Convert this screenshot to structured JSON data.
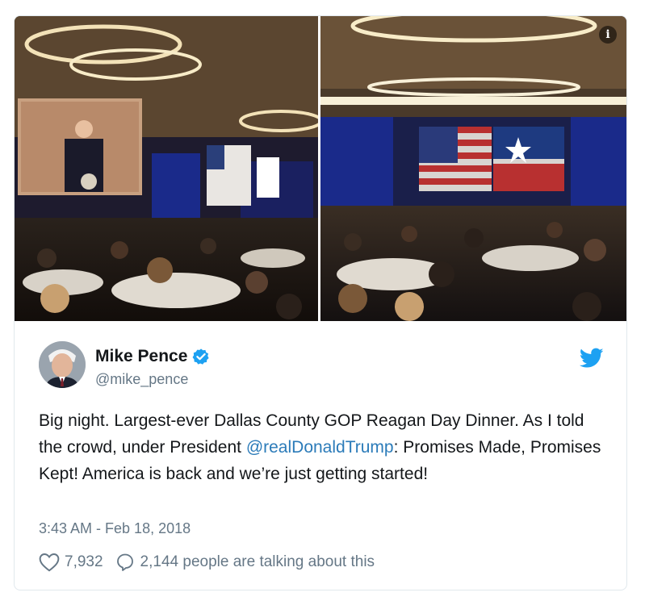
{
  "tweet": {
    "author": {
      "display_name": "Mike Pence",
      "handle": "@mike_pence",
      "verified": true
    },
    "text_before_mention": "Big night. Largest-ever Dallas County GOP Reagan Day Dinner. As I told the crowd, under President ",
    "mention": "@realDonaldTrump",
    "text_after_mention": ": Promises Made, Promises Kept! America is back and we’re just getting started!",
    "timestamp": "3:43 AM - Feb 18, 2018",
    "likes": "7,932",
    "conversation": "2,144 people are talking about this"
  },
  "media": {
    "info_glyph": "i",
    "icons": [
      "info-icon",
      "verified-badge-icon",
      "twitter-bird-icon",
      "heart-icon",
      "reply-icon"
    ]
  },
  "colors": {
    "link": "#2b7bb9",
    "muted": "#657786",
    "verified": "#1da1f2",
    "border": "#e1e8ed"
  }
}
